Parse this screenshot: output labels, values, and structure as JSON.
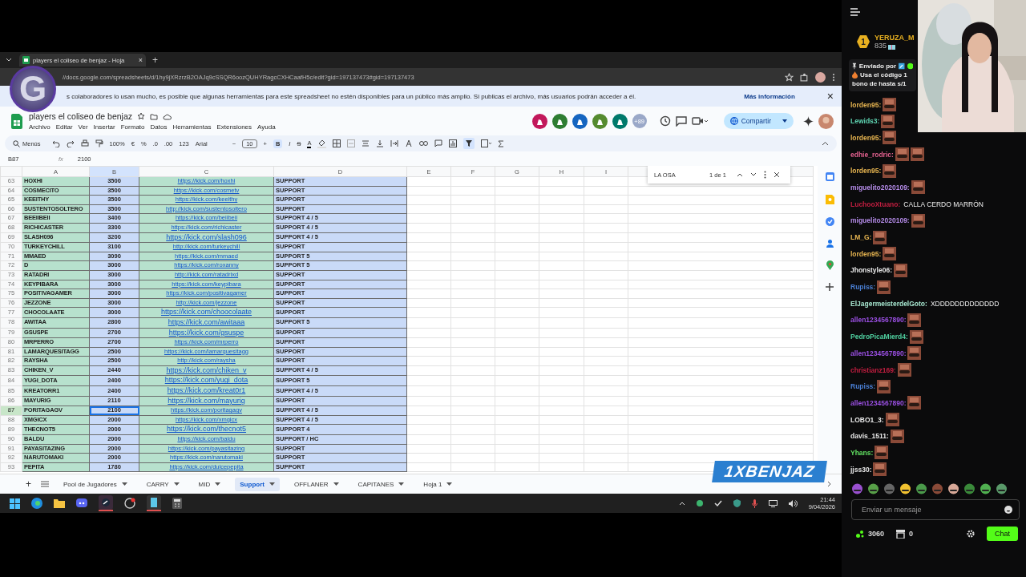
{
  "browser": {
    "tab": {
      "title": "players el coliseo de benjaz - Hoja",
      "close": "×"
    },
    "new_tab": "+",
    "url": "//docs.google.com/spreadsheets/d/1hy9jXRzrzB2OAJq9cSSQR6oozQUHYRagcCXHCaafH5c/edit?gid=197137473#gid=197137473"
  },
  "overlay_logo": "G",
  "banner": {
    "text": "s colaboradores lo usan mucho, es posible que algunas herramientas para este spreadsheet no estén disponibles para un público más amplio. Si publicas el archivo, más usuarios podrán acceder a él.",
    "link": "Más información",
    "close": "×"
  },
  "doc": {
    "title": "players el coliseo de benjaz",
    "menus": [
      "Archivo",
      "Editar",
      "Ver",
      "Insertar",
      "Formato",
      "Datos",
      "Herramientas",
      "Extensiones",
      "Ayuda"
    ],
    "collaborators": [
      {
        "color": "#c2185b"
      },
      {
        "color": "#2e7d32"
      },
      {
        "color": "#1565c0"
      },
      {
        "color": "#558b2f"
      },
      {
        "color": "#00796b"
      }
    ],
    "more_collaborators": "+89",
    "share": "Compartir"
  },
  "toolbar": {
    "menus": "Menús",
    "zoom": "100%",
    "currency": "€",
    "percent": "%",
    "decrease_decimals": ".0",
    "increase_decimals": ".00",
    "format": "123",
    "font": "Arial",
    "minus": "−",
    "font_size": "10",
    "plus": "+",
    "bold": "B",
    "italic": "I",
    "strike": "S",
    "text_color": "A"
  },
  "formula_bar": {
    "cell": "B87",
    "fx": "fx",
    "value": "2100"
  },
  "columns": [
    "A",
    "B",
    "C",
    "D",
    "E",
    "F",
    "G",
    "H",
    "I"
  ],
  "rows": [
    {
      "n": "63",
      "name": "HOXHI",
      "points": "3500",
      "link": "https://kick.com/hoxhi",
      "large": false,
      "role": "SUPPORT",
      "selected": false
    },
    {
      "n": "64",
      "name": "COSMECITO",
      "points": "3500",
      "link": "https://kick.com/cosmetv",
      "large": false,
      "role": "SUPPORT",
      "selected": false
    },
    {
      "n": "65",
      "name": "KEEITHY",
      "points": "3500",
      "link": "https://kick.com/keeithy",
      "large": false,
      "role": "SUPPORT",
      "selected": false
    },
    {
      "n": "66",
      "name": "SUSTENTOSOLTERO",
      "points": "3500",
      "link": "http://kick.com/sustentosoltero",
      "large": false,
      "role": "SUPPORT",
      "selected": false
    },
    {
      "n": "67",
      "name": "BEEIIBEII",
      "points": "3400",
      "link": "https://kick.com/beiibeii",
      "large": false,
      "role": "SUPPORT 4 / 5",
      "selected": false
    },
    {
      "n": "68",
      "name": "RICHICASTER",
      "points": "3300",
      "link": "https://kick.com/richicaster",
      "large": false,
      "role": "SUPPORT 4 / 5",
      "selected": false
    },
    {
      "n": "69",
      "name": "SLASH096",
      "points": "3200",
      "link": "https://kick.com/slash096",
      "large": true,
      "role": "SUPPORT 4 / 5",
      "selected": false
    },
    {
      "n": "70",
      "name": "TURKEYCHILL",
      "points": "3100",
      "link": "http://kick.com/turkeychill",
      "large": false,
      "role": "SUPPORT",
      "selected": false
    },
    {
      "n": "71",
      "name": "MMAED",
      "points": "3090",
      "link": "https://kick.com/mmaed",
      "large": false,
      "role": "SUPPORT 5",
      "selected": false
    },
    {
      "n": "72",
      "name": "D",
      "points": "3000",
      "link": "https://kick.com/roxanny",
      "large": false,
      "role": "SUPPORT 5",
      "selected": false
    },
    {
      "n": "73",
      "name": "RATADRI",
      "points": "3000",
      "link": "http://kick.com/ratadrixd",
      "large": false,
      "role": "SUPPORT",
      "selected": false
    },
    {
      "n": "74",
      "name": "KEYPIBARA",
      "points": "3000",
      "link": "https://kick.com/keypibara",
      "large": false,
      "role": "SUPPORT",
      "selected": false
    },
    {
      "n": "75",
      "name": "POSITIVAGAMER",
      "points": "3000",
      "link": "https://kick.com/positivagamer",
      "large": false,
      "role": "SUPPORT",
      "selected": false
    },
    {
      "n": "76",
      "name": "JEZZONE",
      "points": "3000",
      "link": "http://kick.com/jezzone",
      "large": false,
      "role": "SUPPORT",
      "selected": false
    },
    {
      "n": "77",
      "name": "CHOCOLAATE",
      "points": "3000",
      "link": "https://kick.com/choocolaate",
      "large": true,
      "role": "SUPPORT",
      "selected": false
    },
    {
      "n": "78",
      "name": "AWITAA",
      "points": "2800",
      "link": "https://kick.com/awitaaa",
      "large": true,
      "role": "SUPPORT 5",
      "selected": false
    },
    {
      "n": "79",
      "name": "GSUSPE",
      "points": "2700",
      "link": "https://kick.com/gsuspe",
      "large": true,
      "role": "SUPPORT",
      "selected": false
    },
    {
      "n": "80",
      "name": "MRPERRO",
      "points": "2700",
      "link": "https://kick.com/mrperro",
      "large": false,
      "role": "SUPPORT",
      "selected": false
    },
    {
      "n": "81",
      "name": "LAMARQUESITAGG",
      "points": "2500",
      "link": "https://kick.com/lamarquesitagg",
      "large": false,
      "role": "SUPPORT",
      "selected": false
    },
    {
      "n": "82",
      "name": "RAYSHA",
      "points": "2500",
      "link": "http://kick.com/raysha",
      "large": false,
      "role": "SUPPORT",
      "selected": false
    },
    {
      "n": "83",
      "name": "CHIKEN_V",
      "points": "2440",
      "link": "https://kick.com/chiken_v",
      "large": true,
      "role": "SUPPORT 4 / 5",
      "selected": false
    },
    {
      "n": "84",
      "name": "YUGI_DOTA",
      "points": "2400",
      "link": "https://kick.com/yugi_dota",
      "large": true,
      "role": "SUPPORT 5",
      "selected": false
    },
    {
      "n": "85",
      "name": "KREATORR1",
      "points": "2400",
      "link": "https://kick.com/kreat0r1",
      "large": true,
      "role": "SUPPORT 4 / 5",
      "selected": false
    },
    {
      "n": "86",
      "name": "MAYURIG",
      "points": "2110",
      "link": "https://kick.com/mayurig",
      "large": true,
      "role": "SUPPORT",
      "selected": false
    },
    {
      "n": "87",
      "name": "PORITAGAGV",
      "points": "2100",
      "link": "https://kick.com/poritagagv",
      "large": false,
      "role": "SUPPORT 4 / 5",
      "selected": true
    },
    {
      "n": "88",
      "name": "XMGICX",
      "points": "2000",
      "link": "https://kick.com/xmgicx",
      "large": false,
      "role": "SUPPORT 4 / 5",
      "selected": false
    },
    {
      "n": "89",
      "name": "THECNOT5",
      "points": "2000",
      "link": "https://kick.com/thecnot5",
      "large": true,
      "role": "SUPPORT 4",
      "selected": false
    },
    {
      "n": "90",
      "name": "BALDU",
      "points": "2000",
      "link": "https://kick.com/baldu",
      "large": false,
      "role": "SUPPORT / HC",
      "selected": false
    },
    {
      "n": "91",
      "name": "PAYASITAZING",
      "points": "2000",
      "link": "https://kick.com/payasitazing",
      "large": false,
      "role": "SUPPORT",
      "selected": false
    },
    {
      "n": "92",
      "name": "NARUTOMAKI",
      "points": "2000",
      "link": "https://kick.com/narutomaki",
      "large": false,
      "role": "SUPPORT",
      "selected": false
    },
    {
      "n": "93",
      "name": "PEPITA",
      "points": "1780",
      "link": "https://kick.com/dulcepepita",
      "large": false,
      "role": "SUPPORT",
      "selected": false
    }
  ],
  "find": {
    "query": "LA OSA",
    "count": "1 de 1"
  },
  "add_sheet": "+",
  "sheet_tabs": [
    {
      "label": "Pool de Jugadores",
      "selected": false
    },
    {
      "label": "CARRY",
      "selected": false
    },
    {
      "label": "MID",
      "selected": false
    },
    {
      "label": "Support",
      "selected": true
    },
    {
      "label": "OFFLANER",
      "selected": false
    },
    {
      "label": "CAPITANES",
      "selected": false
    },
    {
      "label": "Hoja 1",
      "selected": false
    }
  ],
  "stream_banner": "1XBENJAZ",
  "taskbar": {
    "time": "21:44",
    "date": "9/04/2026"
  },
  "chat": {
    "leader": {
      "rank": "1",
      "name": "YERUZA_M",
      "count": "835"
    },
    "pinned": {
      "label": "Enviado por",
      "line1": "Usa el código 1",
      "line2": "bono de hasta s/1"
    },
    "messages": [
      {
        "user": "lorden95:",
        "color": "#e6b450",
        "kind": "emote"
      },
      {
        "user": "Lewids3:",
        "color": "#5ed2b0",
        "kind": "emote"
      },
      {
        "user": "lorden95:",
        "color": "#e6b450",
        "kind": "emote"
      },
      {
        "user": "edhie_rodric:",
        "color": "#e0608e",
        "kind": "two_emotes"
      },
      {
        "user": "lorden95:",
        "color": "#e6b450",
        "kind": "emote"
      },
      {
        "user": "miguelito2020109:",
        "color": "#b48be8",
        "kind": "emote"
      },
      {
        "user": "LuchooXtuano:",
        "color": "#c21e40",
        "kind": "text",
        "text": "CALLA CERDO MARRÓN"
      },
      {
        "user": "miguelito2020109:",
        "color": "#b48be8",
        "kind": "emote"
      },
      {
        "user": "LM_G:",
        "color": "#e6b450",
        "kind": "emote"
      },
      {
        "user": "lorden95:",
        "color": "#e6b450",
        "kind": "emote"
      },
      {
        "user": "Jhonstyle06:",
        "color": "#e8e8e8",
        "kind": "emote"
      },
      {
        "user": "Rupiss:",
        "color": "#4a7ed2",
        "kind": "emote"
      },
      {
        "user": "ElJagermeisterdelGoto:",
        "color": "#a6e6cf",
        "kind": "text",
        "text": "XDDDDDDDDDDDDD"
      },
      {
        "user": "allen1234567890:",
        "color": "#9a4fe2",
        "kind": "emote"
      },
      {
        "user": "PedroPicaMierd4:",
        "color": "#4fcf9f",
        "kind": "emote"
      },
      {
        "user": "allen1234567890:",
        "color": "#9a4fe2",
        "kind": "emote"
      },
      {
        "user": "christianz169:",
        "color": "#c21e40",
        "kind": "emote"
      },
      {
        "user": "Rupiss:",
        "color": "#4a7ed2",
        "kind": "emote"
      },
      {
        "user": "allen1234567890:",
        "color": "#9a4fe2",
        "kind": "emote"
      },
      {
        "user": "LOBO1_3:",
        "color": "#e8e8e8",
        "kind": "emote"
      },
      {
        "user": "davis_1511:",
        "color": "#e8e8e8",
        "kind": "emote"
      },
      {
        "user": "Yhans:",
        "color": "#62e262",
        "kind": "emote"
      },
      {
        "user": "jjss30:",
        "color": "#e8e8e8",
        "kind": "emote"
      }
    ],
    "input": {
      "placeholder": "Enviar un mensaje"
    },
    "points": "3060",
    "store": "0",
    "send": "Chat"
  }
}
